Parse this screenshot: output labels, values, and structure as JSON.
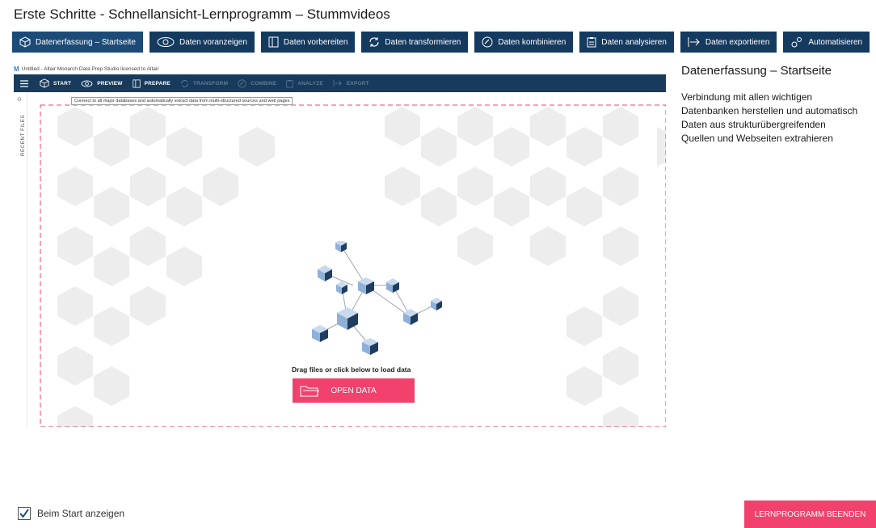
{
  "window_title": "Erste Schritte - Schnellansicht-Lernprogramm – Stummvideos",
  "nav": [
    {
      "label": "Datenerfassung – Startseite",
      "icon": "cube-icon",
      "active": true
    },
    {
      "label": "Daten voranzeigen",
      "icon": "eye-icon",
      "active": false
    },
    {
      "label": "Daten vorbereiten",
      "icon": "columns-icon",
      "active": false
    },
    {
      "label": "Daten transformieren",
      "icon": "transform-icon",
      "active": false
    },
    {
      "label": "Daten kombinieren",
      "icon": "combine-icon",
      "active": false
    },
    {
      "label": "Daten analysieren",
      "icon": "clipboard-icon",
      "active": false
    },
    {
      "label": "Daten exportieren",
      "icon": "export-icon",
      "active": false
    },
    {
      "label": "Automatisieren",
      "icon": "gears-icon",
      "active": false
    }
  ],
  "inner": {
    "caption": "Untitled - Altair Monarch Data Prep Studio licensed to Altair",
    "toolbar": {
      "start": "START",
      "preview": "PREVIEW",
      "prepare": "PREPARE",
      "transform": "TRANSFORM",
      "combine": "COMBINE",
      "analyze": "ANALYZE",
      "export": "EXPORT"
    },
    "tooltip": "Connect to all major databases and automatically extract data from multi-structured sources and web pages",
    "recent_files": "RECENT FILES",
    "drag_text": "Drag files or click below to load data",
    "open_data": "OPEN DATA"
  },
  "panel": {
    "title": "Datenerfassung – Startseite",
    "lines": [
      "Verbindung mit allen wichtigen",
      "Datenbanken herstellen und automatisch",
      "Daten aus strukturübergreifenden",
      "Quellen und Webseiten extrahieren"
    ]
  },
  "footer": {
    "show_on_start": "Beim Start anzeigen",
    "show_on_start_checked": true,
    "finish": "LERNPROGRAMM BEENDEN"
  },
  "colors": {
    "nav_bg": "#153a5f",
    "accent_pink": "#f1416c",
    "toolbar_bg": "#183b5c"
  }
}
